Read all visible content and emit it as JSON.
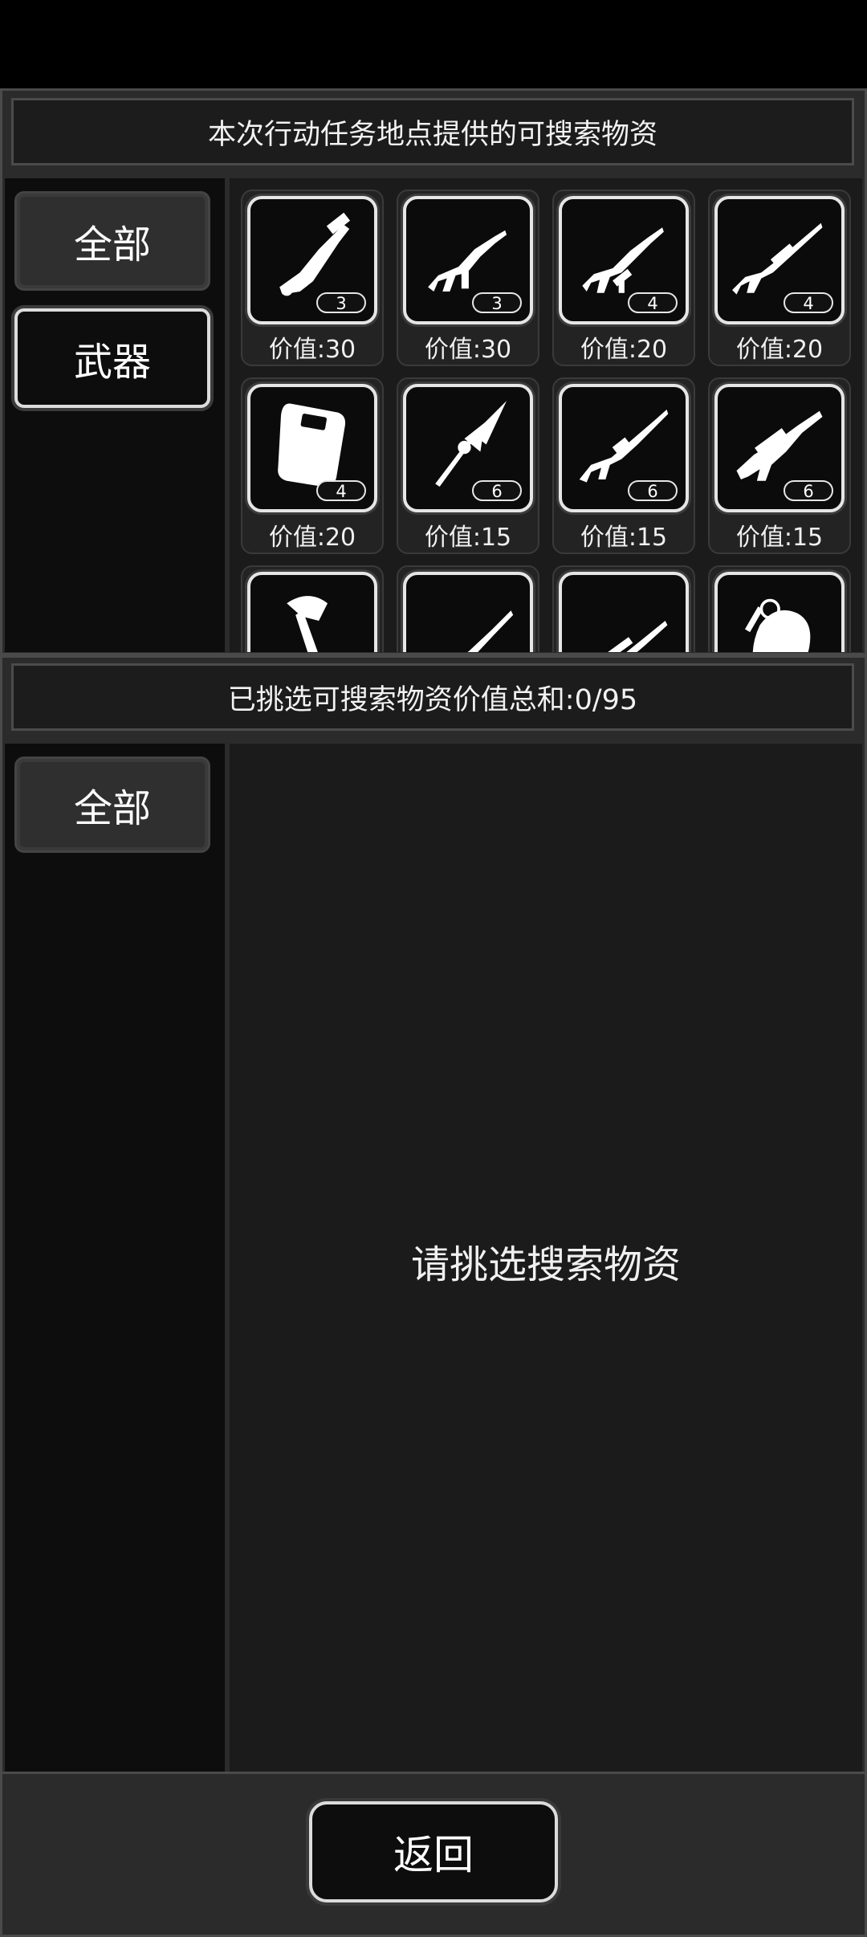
{
  "top_section": {
    "header": "本次行动任务地点提供的可搜索物资",
    "tabs": [
      {
        "label": "全部",
        "state": "inactive"
      },
      {
        "label": "武器",
        "state": "active"
      }
    ],
    "items": [
      {
        "icon": "minigun-icon",
        "count": "3",
        "value_label": "价值:30"
      },
      {
        "icon": "assault-rifle-icon",
        "count": "3",
        "value_label": "价值:30"
      },
      {
        "icon": "rifle-grenade-launcher-icon",
        "count": "4",
        "value_label": "价值:20"
      },
      {
        "icon": "sniper-rifle-icon",
        "count": "4",
        "value_label": "价值:20"
      },
      {
        "icon": "riot-shield-icon",
        "count": "4",
        "value_label": "价值:20"
      },
      {
        "icon": "spear-icon",
        "count": "6",
        "value_label": "价值:15"
      },
      {
        "icon": "m16-rifle-icon",
        "count": "6",
        "value_label": "价值:15"
      },
      {
        "icon": "bullpup-rifle-icon",
        "count": "6",
        "value_label": "价值:15"
      },
      {
        "icon": "axe-icon"
      },
      {
        "icon": "hunting-rifle-icon"
      },
      {
        "icon": "scoped-rifle-icon"
      },
      {
        "icon": "grenade-icon"
      }
    ]
  },
  "bottom_section": {
    "header": "已挑选可搜索物资价值总和:0/95",
    "tabs": [
      {
        "label": "全部",
        "state": "inactive"
      }
    ],
    "empty_message": "请挑选搜索物资"
  },
  "footer": {
    "back_label": "返回"
  }
}
